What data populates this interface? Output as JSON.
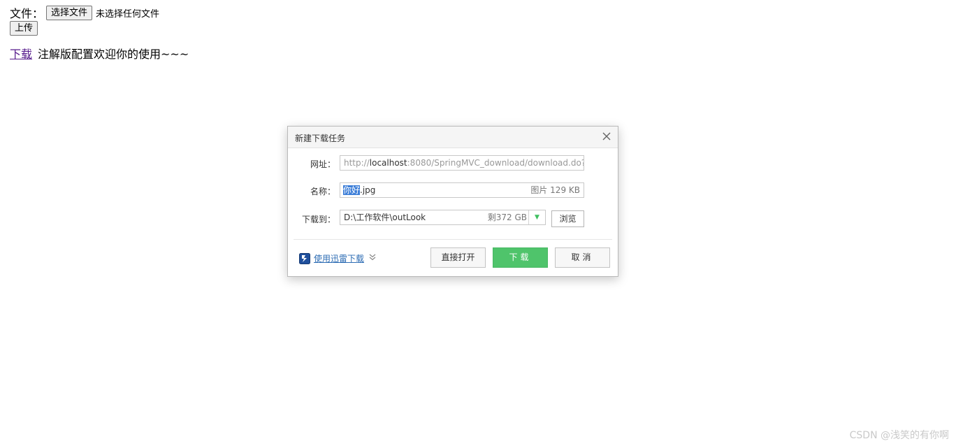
{
  "form": {
    "file_label": "文件：",
    "choose_file_button": "选择文件",
    "no_file_text": "未选择任何文件",
    "upload_button": "上传"
  },
  "download": {
    "link_text": "下载",
    "message": "注解版配置欢迎你的使用~~~"
  },
  "dialog": {
    "title": "新建下载任务",
    "url_label": "网址：",
    "url_prefix": "http://",
    "url_host": "localhost",
    "url_rest": ":8080/SpringMVC_download/download.do?",
    "name_label": "名称：",
    "name_selected": "你好",
    "name_rest": ".jpg",
    "name_meta": "图片 129 KB",
    "path_label": "下载到：",
    "path_value": "D:\\工作软件\\outLook",
    "path_meta": "剩372 GB",
    "browse_button": "浏览",
    "xunlei_link": "使用迅雷下载",
    "open_button": "直接打开",
    "download_button": "下载",
    "cancel_button": "取消"
  },
  "watermark": "CSDN @浅笑的有你啊",
  "colors": {
    "download_green": "#4fc46b",
    "selection_blue": "#3e7fd8",
    "link_purple": "#551a8b",
    "link_blue": "#2e6db4"
  },
  "icons": {
    "close": "close-icon",
    "dropdown": "triangle-down-icon",
    "xunlei": "xunlei-logo-icon",
    "expand": "double-chevron-down-icon"
  }
}
